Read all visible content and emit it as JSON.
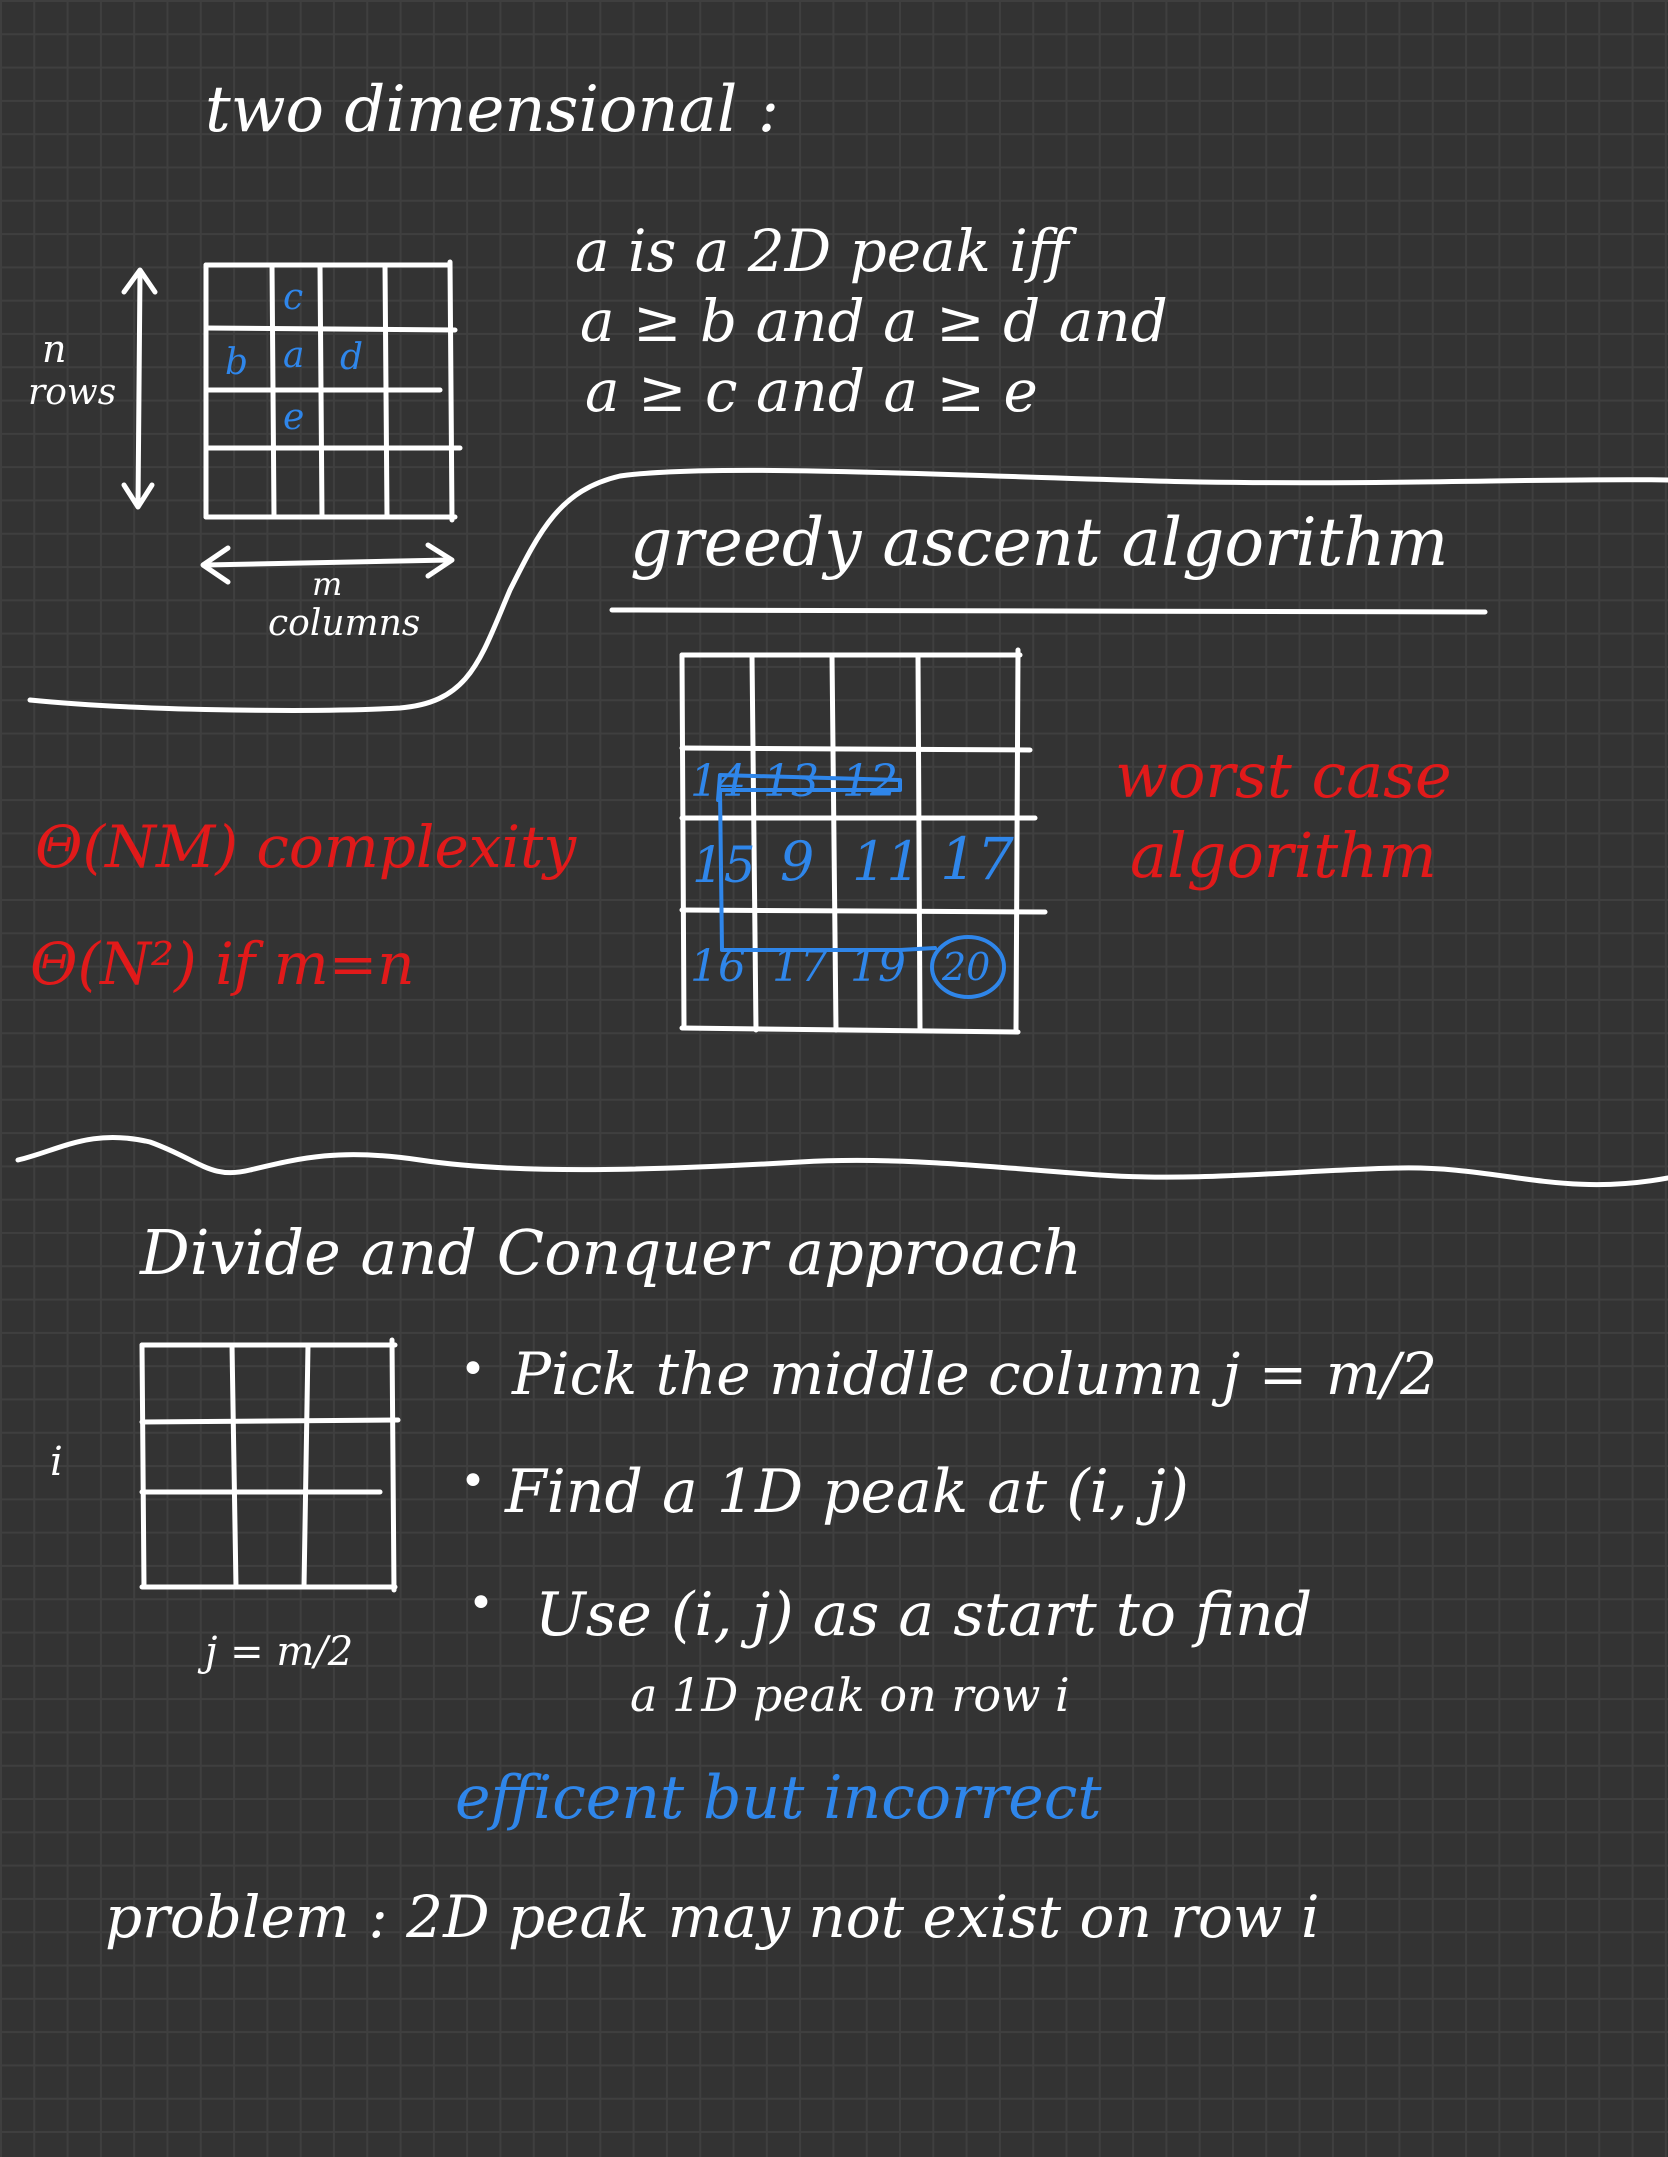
{
  "colors": {
    "background": "#333333",
    "chalk_white": "#ffffff",
    "chalk_red": "#e11a1a",
    "chalk_blue": "#2f86ea"
  },
  "section1": {
    "title": "two dimensional :",
    "grid_letters": {
      "top": "c",
      "left": "b",
      "center": "a",
      "right": "d",
      "bottom": "e"
    },
    "rows_label_n": "n",
    "rows_label": "rows",
    "cols_label_m": "m",
    "cols_label": "columns",
    "definition": [
      "a is a 2D peak iff",
      "a ≥ b and a ≥ d and",
      "a ≥ c and a ≥ e"
    ]
  },
  "section2": {
    "title": "greedy ascent algorithm",
    "grid_values": [
      [
        "14",
        "13",
        "12",
        ""
      ],
      [
        "15",
        "9",
        "11",
        "17"
      ],
      [
        "16",
        "17",
        "19",
        "20"
      ]
    ],
    "peak_value": "20",
    "complexity": [
      "Θ(NM) complexity",
      "Θ(N²) if m=n"
    ],
    "note": [
      "worst case",
      "algorithm"
    ]
  },
  "section3": {
    "title": "Divide and Conquer approach",
    "row_label": "i",
    "col_label": "j = m/2",
    "bullets": [
      "Pick the middle column j = m/2",
      "Find a 1D peak at (i, j)",
      "Use (i, j) as a start to find"
    ],
    "bullet_continuation": "a 1D peak on row i",
    "verdict": "efficent but incorrect",
    "problem": "problem : 2D peak may not exist on row i"
  }
}
